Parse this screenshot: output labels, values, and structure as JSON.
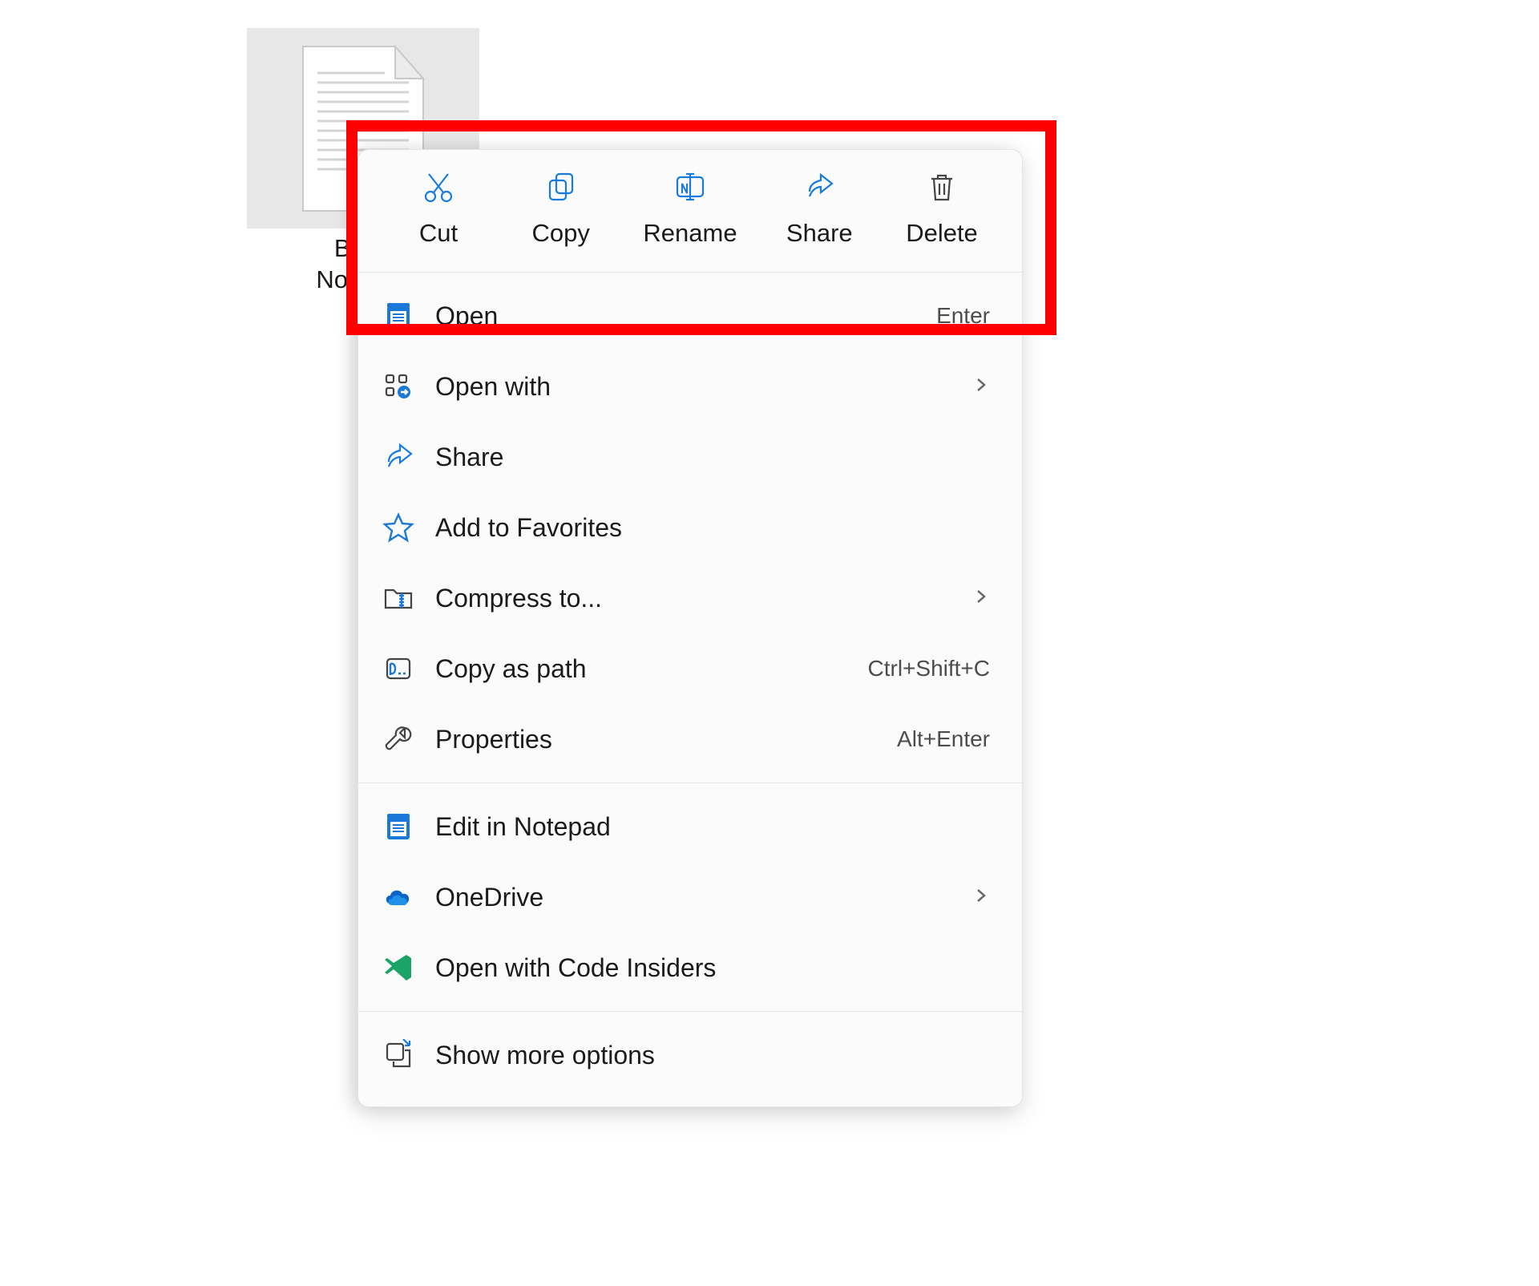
{
  "file": {
    "name_line1": "Brian",
    "name_line2": "Notepad"
  },
  "quick": {
    "cut": {
      "label": "Cut"
    },
    "copy": {
      "label": "Copy"
    },
    "rename": {
      "label": "Rename"
    },
    "share": {
      "label": "Share"
    },
    "delete": {
      "label": "Delete"
    }
  },
  "menu": {
    "open": {
      "label": "Open",
      "shortcut": "Enter"
    },
    "open_with": {
      "label": "Open with"
    },
    "share": {
      "label": "Share"
    },
    "favorites": {
      "label": "Add to Favorites"
    },
    "compress": {
      "label": "Compress to..."
    },
    "copy_path": {
      "label": "Copy as path",
      "shortcut": "Ctrl+Shift+C"
    },
    "properties": {
      "label": "Properties",
      "shortcut": "Alt+Enter"
    },
    "edit_notepad": {
      "label": "Edit in Notepad"
    },
    "onedrive": {
      "label": "OneDrive"
    },
    "code_insiders": {
      "label": "Open with Code Insiders"
    },
    "more": {
      "label": "Show more options"
    }
  }
}
